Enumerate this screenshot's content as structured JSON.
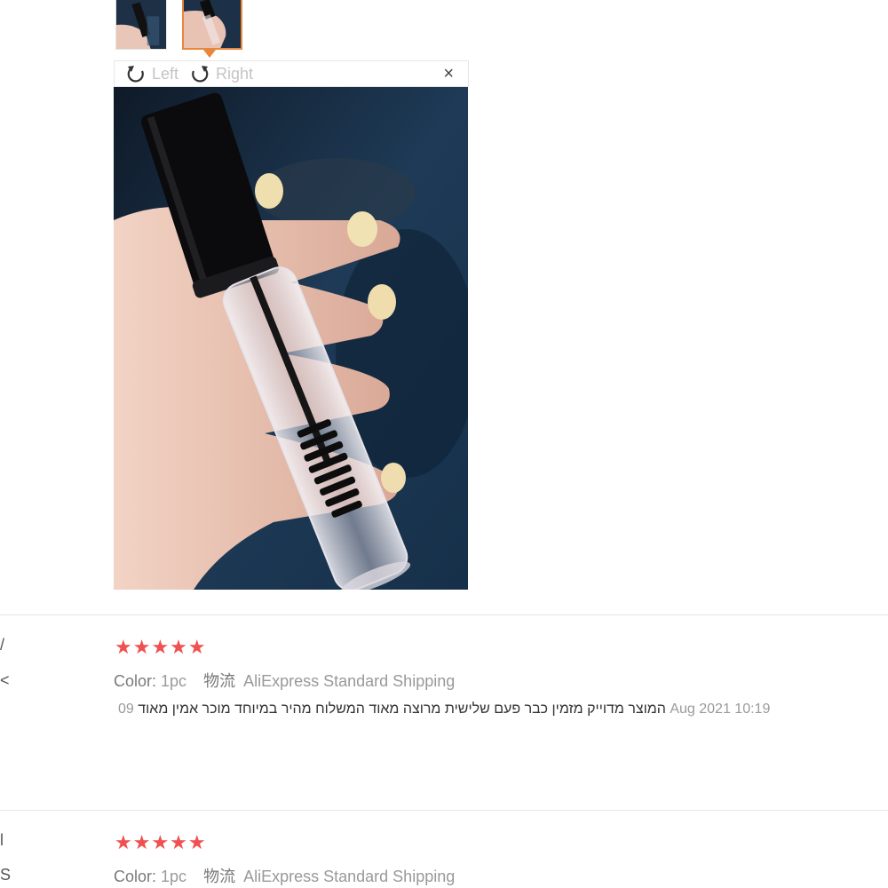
{
  "viewer": {
    "rotate_left_label": "Left",
    "rotate_right_label": "Right",
    "close_label": "×"
  },
  "reviews": [
    {
      "rating": 5,
      "stars": "★★★★★",
      "edge_char_1": "/",
      "edge_char_2": "<",
      "color_label": "Color:",
      "color_value": "1pc",
      "logistics_label": "物流",
      "logistics_value": "AliExpress Standard Shipping",
      "text": "המוצר מדוייק מזמין כבר פעם שלישית מרוצה מאוד המשלוח מהיר במיוחד מוכר אמין מאוד",
      "date_day": "09",
      "date_rest": "Aug 2021 10:19"
    },
    {
      "rating": 5,
      "stars": "★★★★★",
      "edge_char_1": "l",
      "edge_char_2": "S",
      "color_label": "Color:",
      "color_value": "1pc",
      "logistics_label": "物流",
      "logistics_value": "AliExpress Standard Shipping"
    }
  ],
  "colors": {
    "accent": "#e8863d",
    "star": "#f0504f",
    "muted": "#999999"
  },
  "icons": [
    "rotate-left-icon",
    "rotate-right-icon",
    "close-icon",
    "star-icon"
  ]
}
